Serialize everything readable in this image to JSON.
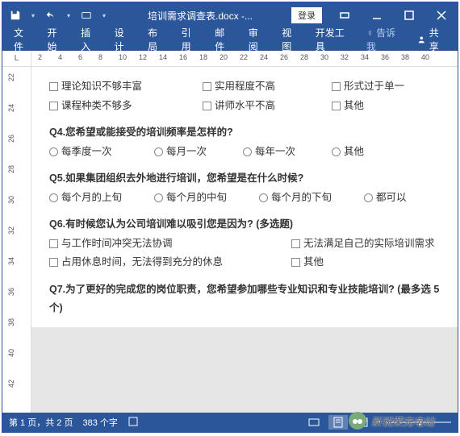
{
  "titlebar": {
    "title": "培训需求调查表.docx -...",
    "login": "登录"
  },
  "tabs": {
    "file": "文件",
    "home": "开始",
    "insert": "插入",
    "design": "设计",
    "layout": "布局",
    "references": "引用",
    "mailings": "邮件",
    "review": "审阅",
    "view": "视图",
    "developer": "开发工具",
    "tellme": "告诉我",
    "share": "共享"
  },
  "ruler_h": [
    "2",
    "4",
    "6",
    "8",
    "10",
    "12",
    "14",
    "16",
    "18",
    "20",
    "22",
    "24",
    "26",
    "28",
    "30",
    "32",
    "34",
    "36",
    "38",
    "40"
  ],
  "ruler_v": [
    "22",
    "24",
    "26",
    "28",
    "30",
    "32",
    "34",
    "36",
    "38",
    "40",
    "42"
  ],
  "doc": {
    "row1": {
      "a": "理论知识不够丰富",
      "b": "实用程度不高",
      "c": "形式过于单一"
    },
    "row2": {
      "a": "课程种类不够多",
      "b": "讲师水平不高",
      "c": "其他"
    },
    "q4": "Q4.您希望或能接受的培训频率是怎样的?",
    "q4opts": {
      "a": "每季度一次",
      "b": "每月一次",
      "c": "每年一次",
      "d": "其他"
    },
    "q5": "Q5.如果集团组织去外地进行培训，您希望是在什么时候?",
    "q5opts": {
      "a": "每个月的上旬",
      "b": "每个月的中旬",
      "c": "每个月的下旬",
      "d": "都可以"
    },
    "q6": "Q6.有时候您认为公司培训难以吸引您是因为?   (多选题)",
    "q6row1": {
      "a": "与工作时间冲突无法协调",
      "b": "无法满足自己的实际培训需求"
    },
    "q6row2": {
      "a": "占用休息时间，无法得到充分的休息",
      "b": "其他"
    },
    "q7": "Q7.为了更好的完成您的岗位职责，您希望参加哪些专业知识和专业技能培训?   (最多选 5",
    "q7_cont": "个)"
  },
  "statusbar": {
    "page": "第 1 页，共 2 页",
    "words": "383 个字"
  },
  "watermark": "新锐荣充电站"
}
